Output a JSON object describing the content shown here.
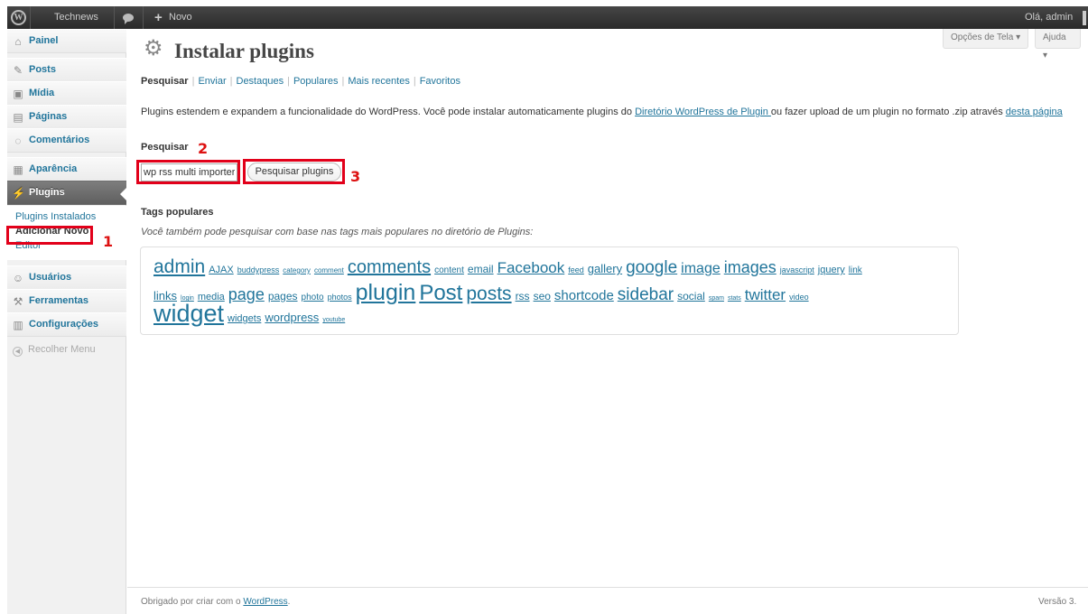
{
  "adminbar": {
    "site_name": "Technews",
    "new_label": "Novo",
    "howdy": "Olá, admin"
  },
  "sidebar": {
    "items": [
      {
        "label": "Painel",
        "icon": "home-icon"
      },
      {
        "label": "Posts",
        "icon": "pin-icon"
      },
      {
        "label": "Mídia",
        "icon": "media-icon"
      },
      {
        "label": "Páginas",
        "icon": "pages-icon"
      },
      {
        "label": "Comentários",
        "icon": "comment-icon"
      },
      {
        "label": "Aparência",
        "icon": "appearance-icon"
      },
      {
        "label": "Plugins",
        "icon": "plugin-icon"
      },
      {
        "label": "Usuários",
        "icon": "users-icon"
      },
      {
        "label": "Ferramentas",
        "icon": "tools-icon"
      },
      {
        "label": "Configurações",
        "icon": "settings-icon"
      }
    ],
    "submenu": [
      "Plugins Instalados",
      "Adicionar Novo",
      "Editor"
    ],
    "collapse": "Recolher Menu"
  },
  "screen_options": {
    "options": "Opções de Tela",
    "help": "Ajuda"
  },
  "page": {
    "title": "Instalar plugins",
    "tabs": [
      "Pesquisar",
      "Enviar",
      "Destaques",
      "Populares",
      "Mais recentes",
      "Favoritos"
    ],
    "intro_before": "Plugins estendem e expandem a funcionalidade do WordPress. Você pode instalar automaticamente plugins do ",
    "intro_link1": "Diretório WordPress de Plugin ",
    "intro_middle": "ou fazer upload de um plugin no formato .zip através ",
    "intro_link2": "desta página"
  },
  "search": {
    "label": "Pesquisar",
    "value": "wp rss multi importer",
    "button": "Pesquisar plugins"
  },
  "tags": {
    "title": "Tags populares",
    "description": "Você também pode pesquisar com base nas tags mais populares no diretório de Plugins:",
    "lines": [
      [
        [
          "admin",
          21
        ],
        [
          "AJAX",
          11
        ],
        [
          "buddypress",
          9
        ],
        [
          "category",
          8
        ],
        [
          "comment",
          8
        ],
        [
          "comments",
          20
        ],
        [
          "content",
          10
        ],
        [
          "email",
          12
        ],
        [
          "Facebook",
          17
        ],
        [
          "feed",
          9
        ],
        [
          "gallery",
          13
        ],
        [
          "google",
          19
        ],
        [
          "image",
          16
        ],
        [
          "images",
          18
        ],
        [
          "javascript",
          9
        ],
        [
          "jquery",
          11
        ],
        [
          "link",
          10
        ]
      ],
      [
        [
          "links",
          13
        ],
        [
          "login",
          7
        ],
        [
          "media",
          11
        ],
        [
          "page",
          18
        ],
        [
          "pages",
          12
        ],
        [
          "photo",
          10
        ],
        [
          "photos",
          9
        ],
        [
          "plugin",
          25
        ],
        [
          "Post",
          24
        ],
        [
          "posts",
          21
        ],
        [
          "rss",
          12
        ],
        [
          "seo",
          12
        ],
        [
          "shortcode",
          15
        ],
        [
          "sidebar",
          19
        ],
        [
          "social",
          12
        ],
        [
          "spam",
          7
        ],
        [
          "stats",
          7
        ],
        [
          "twitter",
          17
        ],
        [
          "video",
          9
        ]
      ],
      [
        [
          "widget",
          27
        ],
        [
          "widgets",
          11
        ],
        [
          "wordpress",
          13
        ],
        [
          "youtube",
          7
        ]
      ]
    ]
  },
  "annotations": {
    "n1": "1",
    "n2": "2",
    "n3": "3"
  },
  "footer": {
    "thanks_before": "Obrigado por criar com o ",
    "thanks_link": "WordPress",
    "thanks_after": ".",
    "version": "Versão 3."
  }
}
